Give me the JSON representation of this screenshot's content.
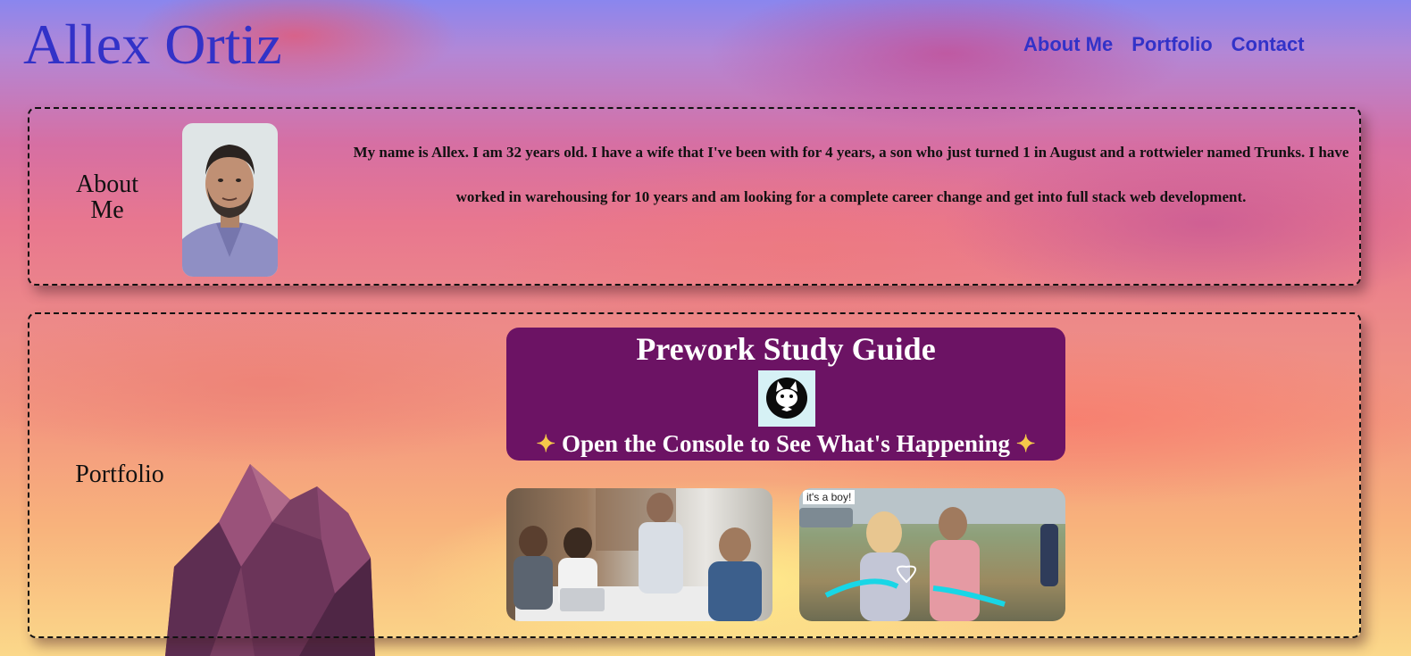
{
  "header": {
    "title": "Allex Ortiz",
    "nav": [
      {
        "label": "About Me"
      },
      {
        "label": "Portfolio"
      },
      {
        "label": "Contact"
      }
    ]
  },
  "about": {
    "heading": "About Me",
    "bio": "My name is Allex. I am 32 years old. I have a wife that I've been with for 4 years, a son who just turned 1 in August and a rottwieler named Trunks. I have worked in warehousing for 10 years and am looking for a complete career change and get into full stack web development."
  },
  "portfolio": {
    "heading": "Portfolio",
    "projects": [
      {
        "title": "Prework Study Guide",
        "subtitle": "Open the Console to See What's Happening",
        "icon": "cat-logo-icon",
        "background": "#6c1364"
      },
      {
        "image": "team-meeting-photo"
      },
      {
        "image": "gender-reveal-photo",
        "caption": "it's a boy!"
      }
    ]
  },
  "colors": {
    "accent": "#3232c8",
    "text": "#111111"
  }
}
